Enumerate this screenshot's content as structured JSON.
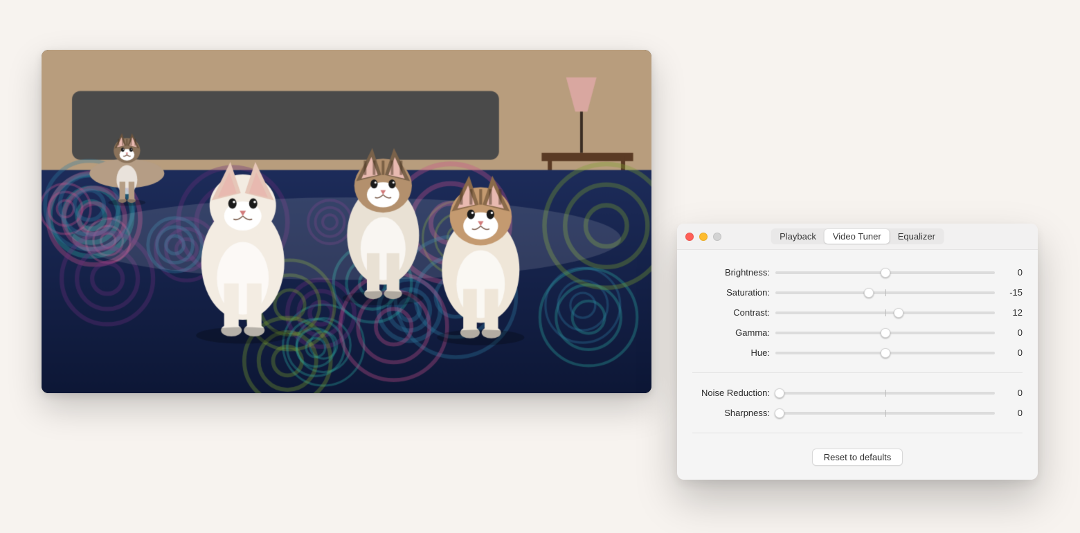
{
  "video": {
    "description": "Three kittens sitting on a patterned bedspread"
  },
  "tuner": {
    "tabs": [
      "Playback",
      "Video Tuner",
      "Equalizer"
    ],
    "active_tab_index": 1,
    "groups": [
      {
        "sliders": [
          {
            "label": "Brightness:",
            "min": -100,
            "max": 100,
            "value": 0,
            "center_tick": true,
            "thumb_at_start": false
          },
          {
            "label": "Saturation:",
            "min": -100,
            "max": 100,
            "value": -15,
            "center_tick": true,
            "thumb_at_start": false
          },
          {
            "label": "Contrast:",
            "min": -100,
            "max": 100,
            "value": 12,
            "center_tick": true,
            "thumb_at_start": false
          },
          {
            "label": "Gamma:",
            "min": -100,
            "max": 100,
            "value": 0,
            "center_tick": true,
            "thumb_at_start": false
          },
          {
            "label": "Hue:",
            "min": -100,
            "max": 100,
            "value": 0,
            "center_tick": true,
            "thumb_at_start": false
          }
        ]
      },
      {
        "sliders": [
          {
            "label": "Noise Reduction:",
            "min": 0,
            "max": 100,
            "value": 0,
            "center_tick": true,
            "thumb_at_start": true
          },
          {
            "label": "Sharpness:",
            "min": 0,
            "max": 100,
            "value": 0,
            "center_tick": true,
            "thumb_at_start": true
          }
        ]
      }
    ],
    "reset_label": "Reset to defaults"
  }
}
